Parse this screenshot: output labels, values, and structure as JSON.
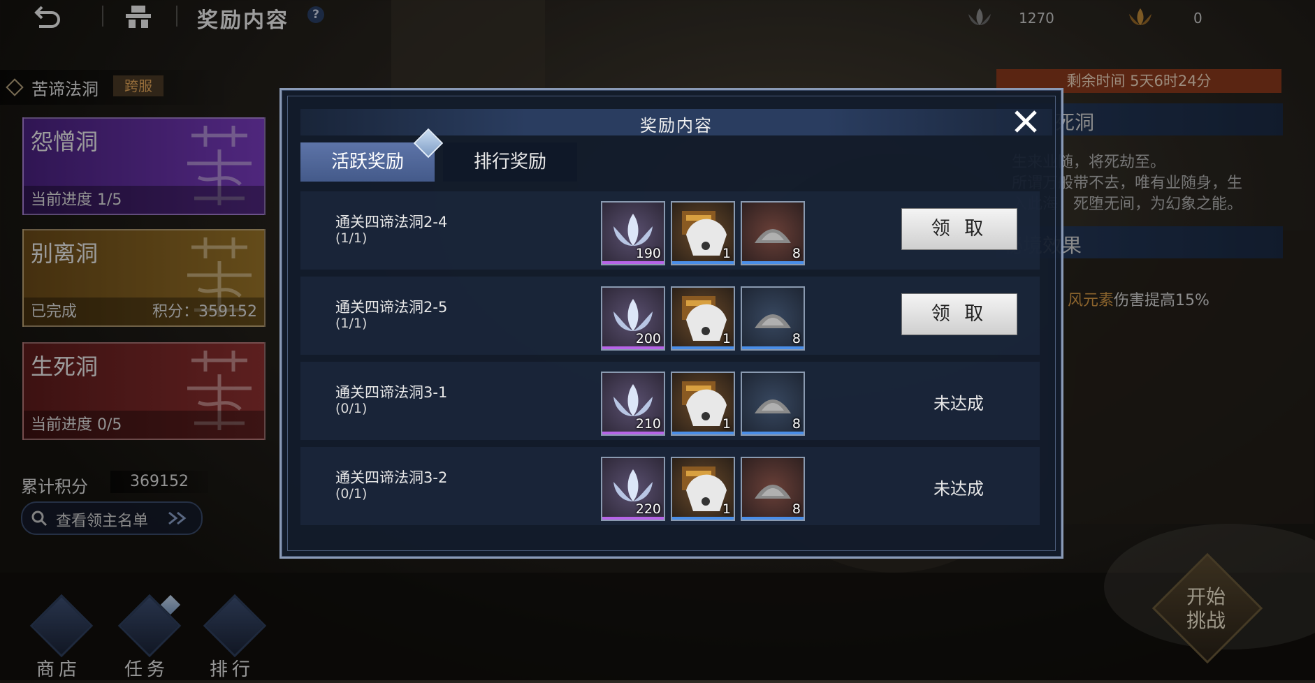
{
  "header": {
    "title": "奖励内容",
    "help": "?"
  },
  "currencies": [
    {
      "value": "1270"
    },
    {
      "value": "0"
    }
  ],
  "left_panel": {
    "region_title": "苦谛法洞",
    "region_badge": "跨服",
    "caves": [
      {
        "name": "怨憎洞",
        "status": "当前进度 1/5",
        "score": "",
        "color": "#5b2c9a"
      },
      {
        "name": "别离洞",
        "status": "已完成",
        "score": "积分：359152",
        "color": "#8a6320"
      },
      {
        "name": "生死洞",
        "status": "当前进度 0/5",
        "score": "",
        "color": "#7a2424"
      }
    ],
    "total_label": "累计积分",
    "total_value": "369152",
    "lords_button": "查看领主名单"
  },
  "bottom_nav": [
    {
      "label": "商店"
    },
    {
      "label": "任务"
    },
    {
      "label": "排行"
    }
  ],
  "right_panel": {
    "timer": "剩余时间  5天6时24分",
    "header1": "死洞",
    "desc_lines": [
      "生来业随，将死劫至。",
      "所谓万般带不去，唯有业随身，生",
      "入此海，死堕无间，为幻象之能。"
    ],
    "header2": "秘境效果",
    "effect_highlight": "风元素",
    "effect_rest": "伤害提高15%",
    "start_button": "开始挑战"
  },
  "modal": {
    "title": "奖励内容",
    "tabs": [
      {
        "label": "活跃奖励",
        "active": true
      },
      {
        "label": "排行奖励",
        "active": false
      }
    ],
    "rows": [
      {
        "title": "通关四谛法洞2-4",
        "progress": "(1/1)",
        "items": [
          "190",
          "1",
          "8"
        ],
        "action": "领 取",
        "claimable": true
      },
      {
        "title": "通关四谛法洞2-5",
        "progress": "(1/1)",
        "items": [
          "200",
          "1",
          "8"
        ],
        "action": "领 取",
        "claimable": true
      },
      {
        "title": "通关四谛法洞3-1",
        "progress": "(0/1)",
        "items": [
          "210",
          "1",
          "8"
        ],
        "action": "未达成",
        "claimable": false
      },
      {
        "title": "通关四谛法洞3-2",
        "progress": "(0/1)",
        "items": [
          "220",
          "1",
          "8"
        ],
        "action": "未达成",
        "claimable": false
      }
    ]
  },
  "item_icons": [
    "lotus-icon",
    "fan-chest-icon",
    "ore-pile-icon"
  ],
  "colors": {
    "rarity_purple": "#b764e8",
    "rarity_blue": "#4a8ee8",
    "timer_bg": "#8a3a1c",
    "highlight": "#d79a45"
  }
}
